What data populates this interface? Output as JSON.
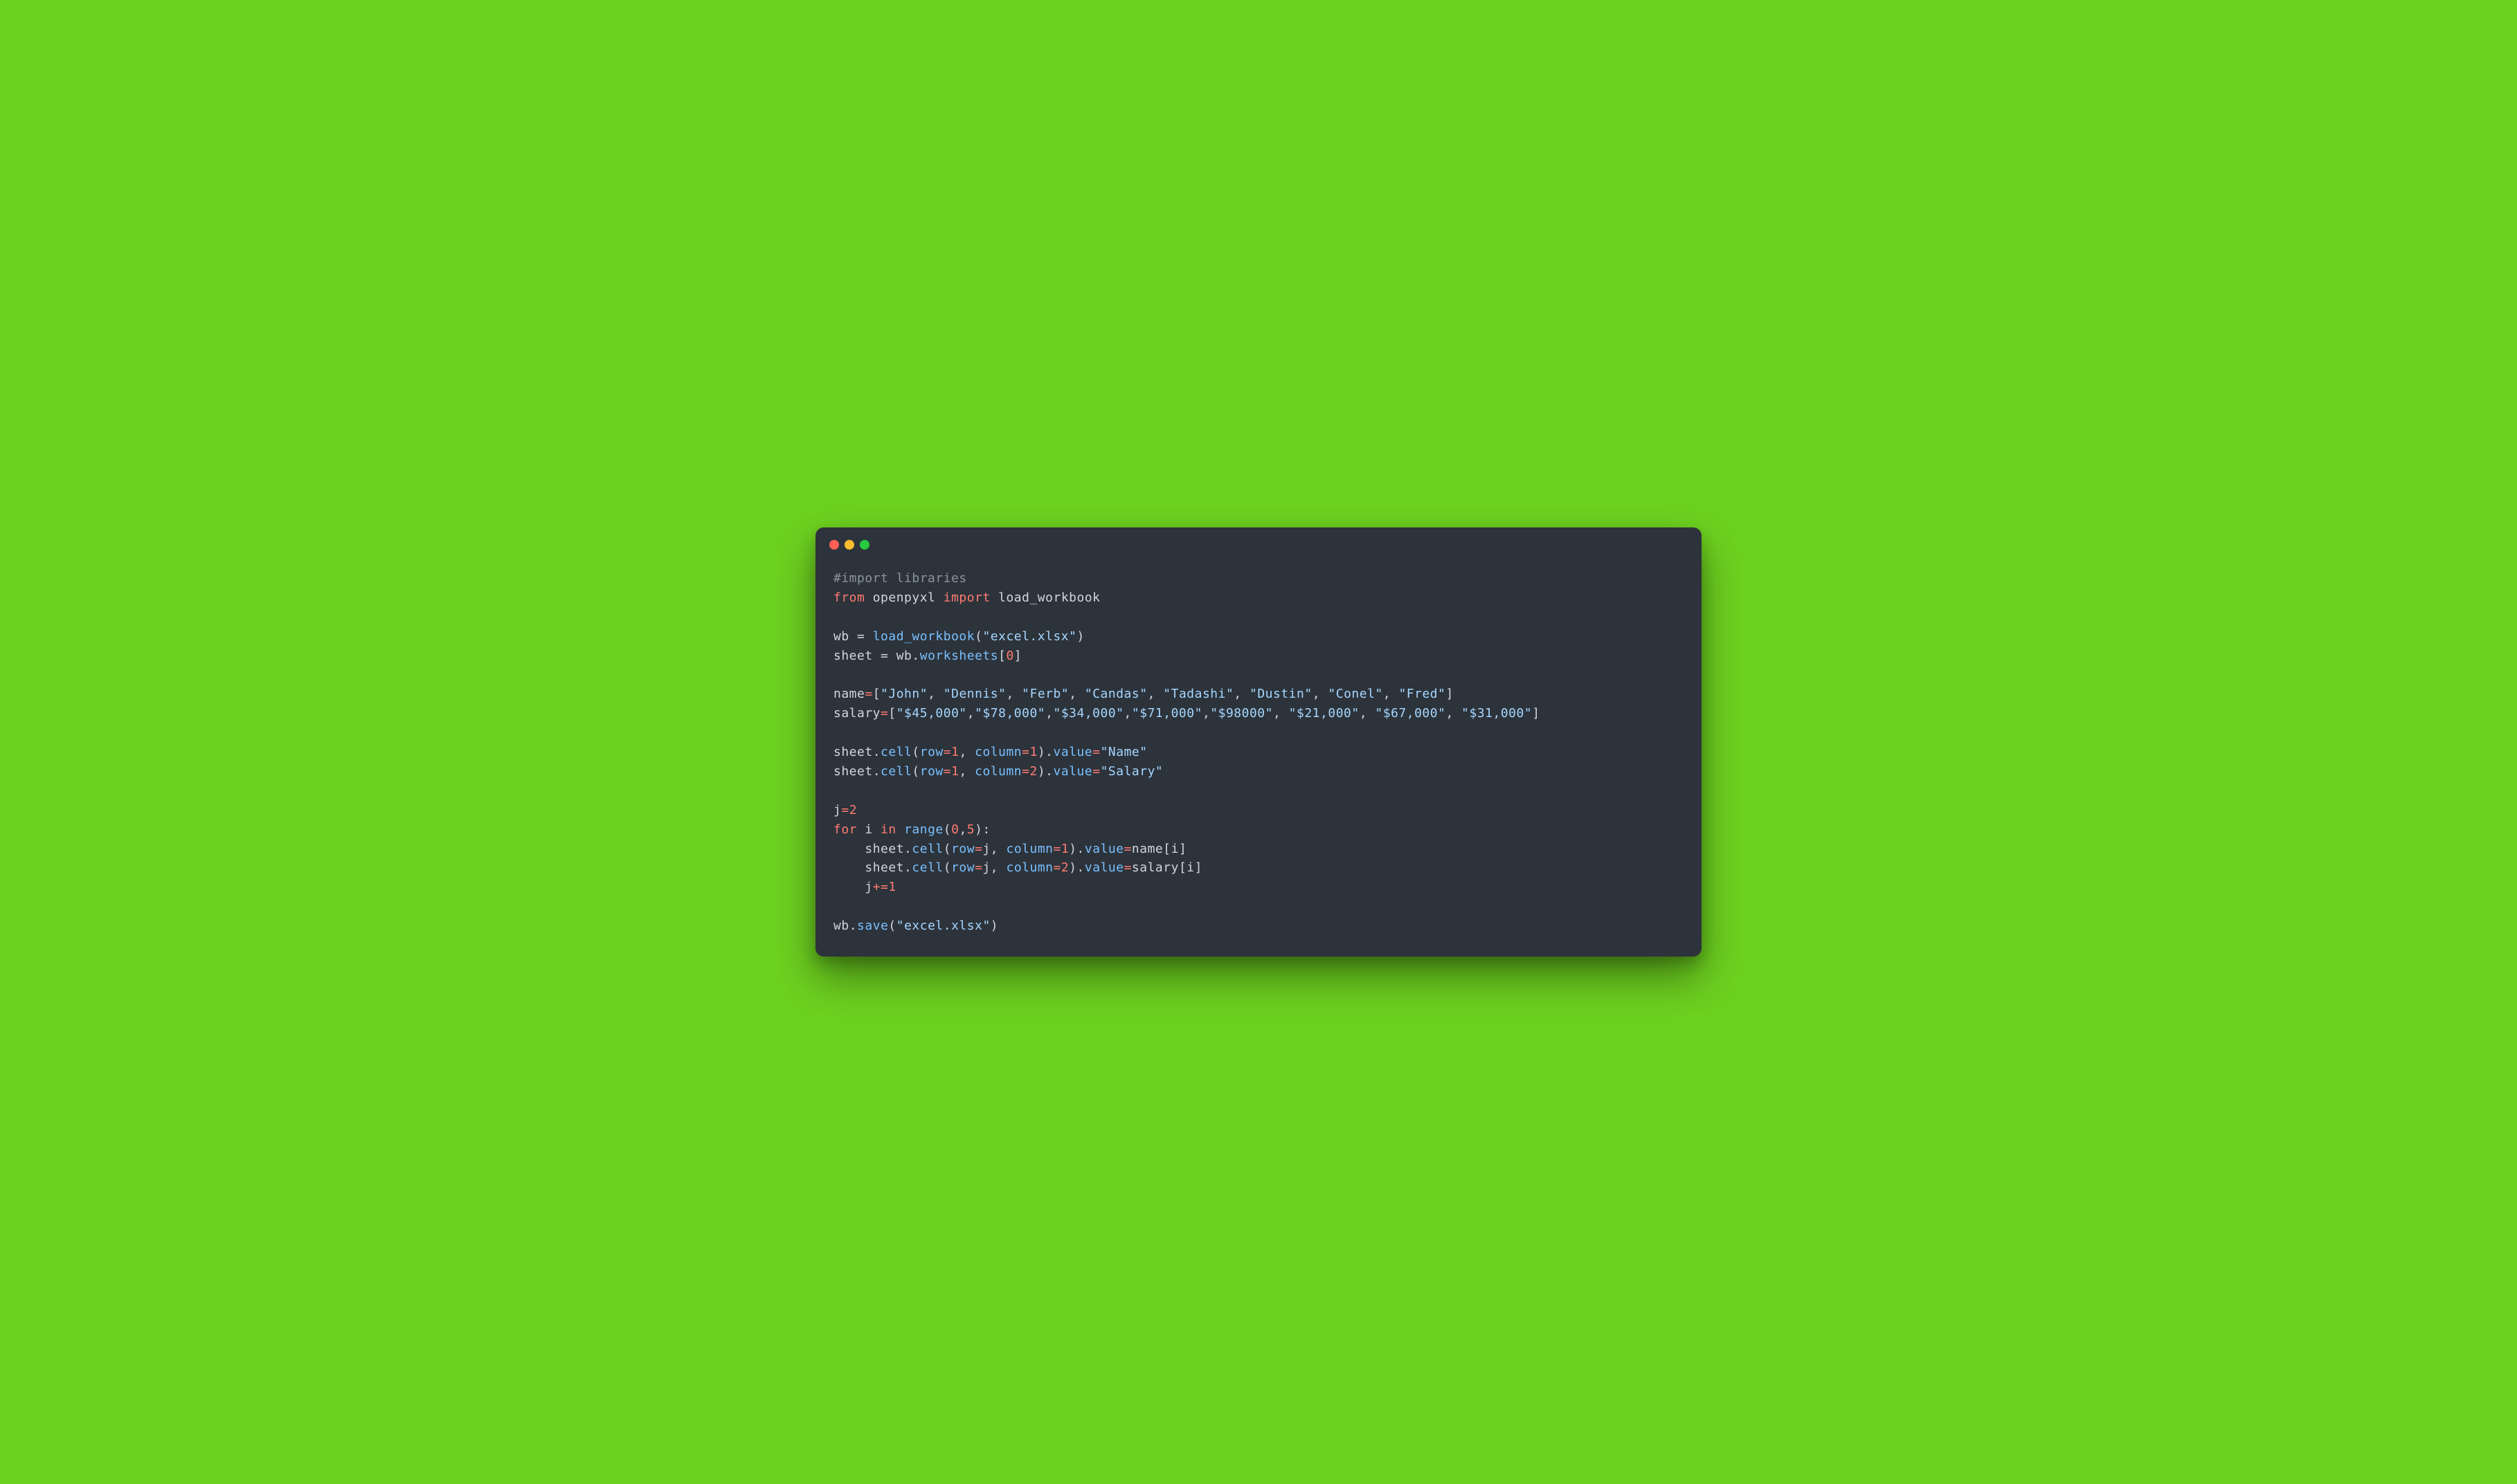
{
  "code": {
    "line01_comment": "#import libraries",
    "line02_from": "from",
    "line02_module": "openpyxl",
    "line02_import": "import",
    "line02_name": "load_workbook",
    "line04_wb": "wb",
    "line04_eq": " = ",
    "line04_func": "load_workbook",
    "line04_open": "(",
    "line04_arg": "\"excel.xlsx\"",
    "line04_close": ")",
    "line05_sheet": "sheet",
    "line05_eq": " = ",
    "line05_wb": "wb",
    "line05_dot": ".",
    "line05_attr": "worksheets",
    "line05_br_open": "[",
    "line05_idx": "0",
    "line05_br_close": "]",
    "line07_name": "name",
    "line07_eq": "=",
    "line07_list_open": "[",
    "line07_items": [
      "\"John\"",
      "\"Dennis\"",
      "\"Ferb\"",
      "\"Candas\"",
      "\"Tadashi\"",
      "\"Dustin\"",
      "\"Conel\"",
      "\"Fred\""
    ],
    "line07_list_close": "]",
    "line08_salary": "salary",
    "line08_eq": "=",
    "line08_list_open": "[",
    "line08_items": [
      "\"$45,000\"",
      "\"$78,000\"",
      "\"$34,000\"",
      "\"$71,000\"",
      "\"$98000\"",
      "\"$21,000\"",
      "\"$67,000\"",
      "\"$31,000\""
    ],
    "line08_list_close": "]",
    "line10_sheet": "sheet",
    "line10_cell": "cell",
    "line10_row_kw": "row",
    "line10_row_val": "1",
    "line10_col_kw": "column",
    "line10_col_val": "1",
    "line10_value": "value",
    "line10_str": "\"Name\"",
    "line11_col_val": "2",
    "line11_str": "\"Salary\"",
    "line13_j": "j",
    "line13_eq": "=",
    "line13_val": "2",
    "line14_for": "for",
    "line14_i": "i",
    "line14_in": "in",
    "line14_range": "range",
    "line14_args_open": "(",
    "line14_arg0": "0",
    "line14_comma": ",",
    "line14_arg1": "5",
    "line14_args_close": "):",
    "line15_indent": "    ",
    "line15_sheet": "sheet",
    "line15_cell": "cell",
    "line15_row_kw": "row",
    "line15_row_val": "j",
    "line15_col_kw": "column",
    "line15_col_val": "1",
    "line15_value": "value",
    "line15_rhs": "name",
    "line15_idx": "i",
    "line16_col_val": "2",
    "line16_rhs": "salary",
    "line17_j": "j",
    "line17_op": "+=",
    "line17_val": "1",
    "line19_wb": "wb",
    "line19_save": "save",
    "line19_arg": "\"excel.xlsx\""
  }
}
